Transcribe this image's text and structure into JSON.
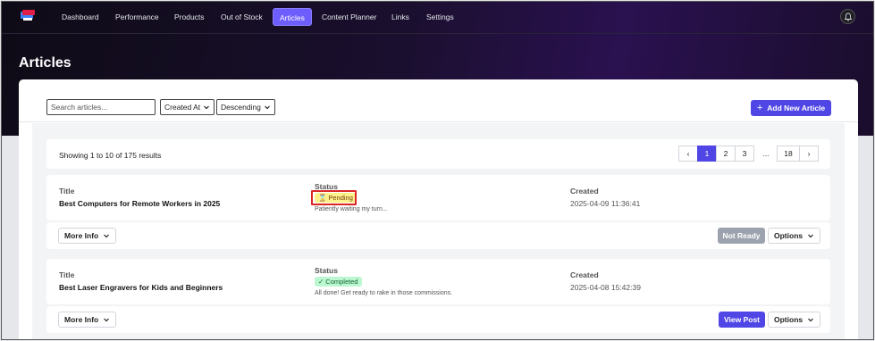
{
  "nav": {
    "items": [
      {
        "label": "Dashboard"
      },
      {
        "label": "Performance"
      },
      {
        "label": "Products"
      },
      {
        "label": "Out of Stock"
      },
      {
        "label": "Articles",
        "active": true
      },
      {
        "label": "Content Planner"
      },
      {
        "label": "Links"
      },
      {
        "label": "Settings"
      }
    ],
    "bell_icon": "bell-icon"
  },
  "page": {
    "title": "Articles"
  },
  "toolbar": {
    "search_placeholder": "Search articles...",
    "sort_field": "Created At",
    "sort_order": "Descending",
    "add_label": "Add New Article"
  },
  "results": {
    "summary": "Showing 1 to 10 of 175 results"
  },
  "pagination": {
    "prev": "‹",
    "pages": [
      "1",
      "2",
      "3"
    ],
    "ellipsis": "...",
    "last": "18",
    "next": "›",
    "current": "1"
  },
  "articles": [
    {
      "title_label": "Title",
      "title": "Best Computers for Remote Workers in 2025",
      "status_label": "Status",
      "status": "Pending",
      "status_icon": "hourglass-icon",
      "status_note": "Patiently waiting my turn...",
      "created_label": "Created",
      "created": "2025-04-09 11:36:41",
      "more_info": "More Info",
      "action": "Not Ready",
      "options": "Options"
    },
    {
      "title_label": "Title",
      "title": "Best Laser Engravers for Kids and Beginners",
      "status_label": "Status",
      "status": "Completed",
      "status_icon": "check-icon",
      "status_note": "All done! Get ready to rake in those commissions.",
      "created_label": "Created",
      "created": "2025-04-08 15:42:39",
      "more_info": "More Info",
      "action": "View Post",
      "options": "Options"
    }
  ],
  "colors": {
    "accent": "#4f46e5",
    "pending": "#fef08a",
    "completed": "#bbf7d0",
    "highlight": "#dc2626"
  }
}
